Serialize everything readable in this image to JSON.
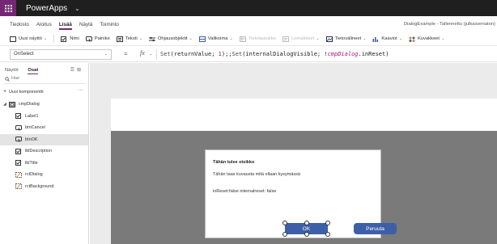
{
  "app": {
    "name": "PowerApps",
    "document_title": "DialogExample - Tallennettu (julkaisematon)"
  },
  "menu": {
    "tabs": [
      "Tiedosto",
      "Aloitus",
      "Lisää",
      "Näytä",
      "Toiminto"
    ],
    "active_tab": "Lisää"
  },
  "ribbon": {
    "items": [
      {
        "label": "Uusi näyttö",
        "icon": "new-screen-icon",
        "dropdown": true,
        "enabled": true
      },
      {
        "label": "Nimi",
        "icon": "checkbox-icon",
        "dropdown": false,
        "enabled": true
      },
      {
        "label": "Painike",
        "icon": "button-icon",
        "dropdown": false,
        "enabled": true
      },
      {
        "label": "Teksti",
        "icon": "text-icon",
        "dropdown": true,
        "enabled": true
      },
      {
        "label": "Ohjausobjektit",
        "icon": "controls-icon",
        "dropdown": true,
        "enabled": true
      },
      {
        "label": "Valikoima",
        "icon": "gallery-icon",
        "dropdown": true,
        "enabled": true
      },
      {
        "label": "Tietotaulukko",
        "icon": "datatable-icon",
        "dropdown": false,
        "enabled": false
      },
      {
        "label": "Lomakkeet",
        "icon": "forms-icon",
        "dropdown": true,
        "enabled": false
      },
      {
        "label": "Tietovälineet",
        "icon": "media-icon",
        "dropdown": true,
        "enabled": true
      },
      {
        "label": "Kaaviot",
        "icon": "charts-icon",
        "dropdown": true,
        "enabled": true
      },
      {
        "label": "Kuvakkeet",
        "icon": "icons-icon",
        "dropdown": true,
        "enabled": true
      }
    ]
  },
  "formula_bar": {
    "property": "OnSelect",
    "equals": "=",
    "fx": "fx",
    "formula_parts": [
      {
        "t": "Set",
        "k": "fn"
      },
      {
        "t": "(returnValue; ",
        "k": "plain"
      },
      {
        "t": "1",
        "k": "num"
      },
      {
        "t": ");;",
        "k": "plain"
      },
      {
        "t": "Set",
        "k": "fn"
      },
      {
        "t": "(internalDialogVisible; !",
        "k": "plain"
      },
      {
        "t": "cmpDialog",
        "k": "ctl"
      },
      {
        "t": ".inReset)",
        "k": "plain"
      }
    ]
  },
  "left_panel": {
    "tabs": [
      "Näytöt",
      "Osat"
    ],
    "active_tab": "Osat",
    "search_placeholder": "Hae",
    "new_component_label": "Uusi komponentti",
    "more_label": "···",
    "tree": [
      {
        "label": "cmpDialog",
        "level": 0,
        "icon": "component-icon",
        "selected": false
      },
      {
        "label": "Label1",
        "level": 1,
        "icon": "label-icon",
        "selected": false
      },
      {
        "label": "btnCancel",
        "level": 1,
        "icon": "button-icon",
        "selected": false
      },
      {
        "label": "btnOK",
        "level": 1,
        "icon": "button-icon",
        "selected": true
      },
      {
        "label": "lblDescription",
        "level": 1,
        "icon": "label-icon",
        "selected": false
      },
      {
        "label": "lblTitle",
        "level": 1,
        "icon": "label-icon",
        "selected": false
      },
      {
        "label": "rctDialog",
        "level": 1,
        "icon": "rectangle-icon",
        "selected": false
      },
      {
        "label": "rctBackground",
        "level": 1,
        "icon": "rectangle-icon",
        "selected": false
      }
    ]
  },
  "dialog": {
    "title": "Tähän tulee otsikko",
    "description": "Tähän taas kuvausta mitä ollaan kysymässä",
    "state_text": "inReset:false internalreset: false",
    "ok_label": "OK",
    "cancel_label": "Peruuta"
  },
  "colors": {
    "brand": "#742774",
    "button": "#3c5fa8",
    "overlay": "#7a7a7a"
  }
}
